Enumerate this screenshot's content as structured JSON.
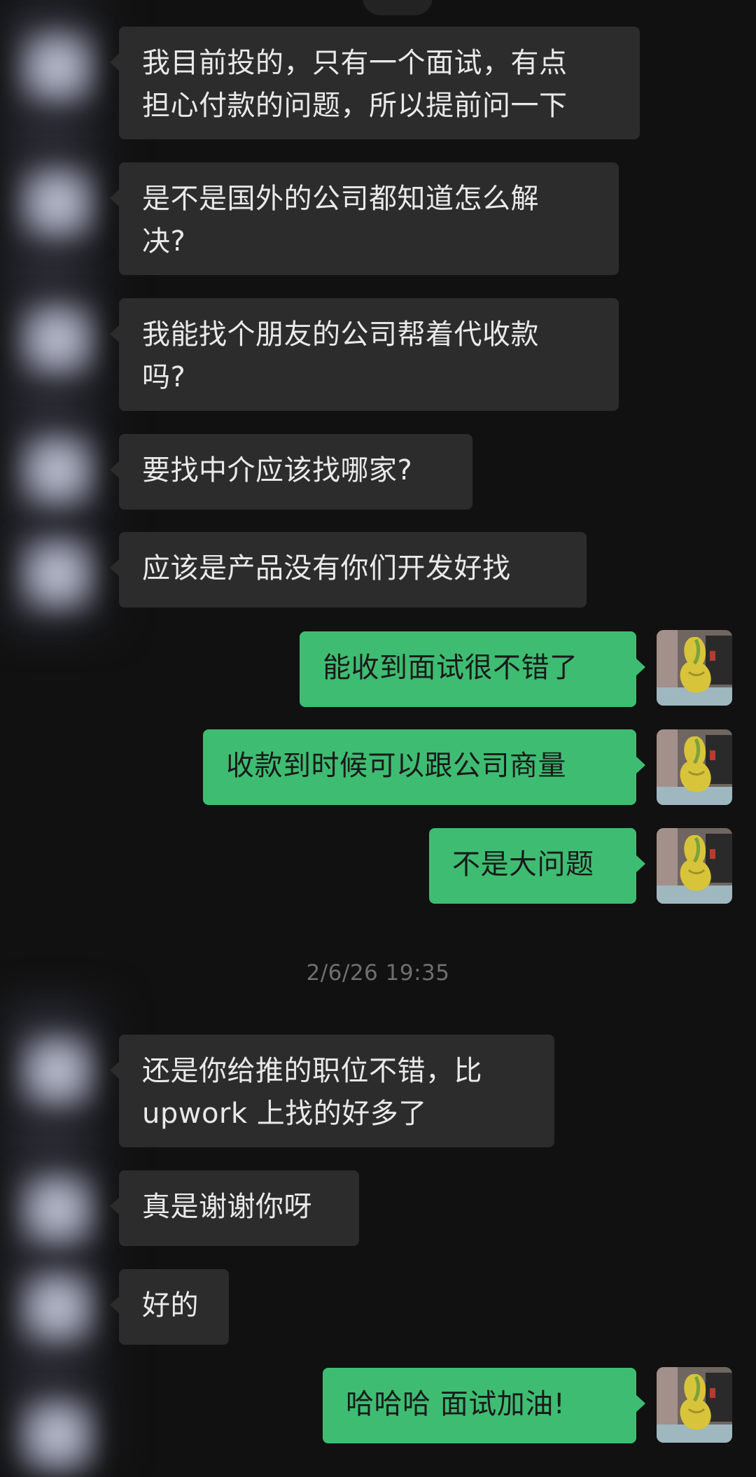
{
  "conversation": {
    "messages": [
      {
        "id": "m1",
        "side": "left",
        "text": "我目前投的，只有一个面试，有点\n担心付款的问题，所以提前问一下"
      },
      {
        "id": "m2",
        "side": "left",
        "text": "是不是国外的公司都知道怎么解\n决?"
      },
      {
        "id": "m3",
        "side": "left",
        "text": "我能找个朋友的公司帮着代收款\n吗?"
      },
      {
        "id": "m4",
        "side": "left",
        "text": "要找中介应该找哪家?"
      },
      {
        "id": "m5",
        "side": "left",
        "text": "应该是产品没有你们开发好找"
      },
      {
        "id": "m6",
        "side": "right",
        "text": "能收到面试很不错了"
      },
      {
        "id": "m7",
        "side": "right",
        "text": "收款到时候可以跟公司商量"
      },
      {
        "id": "m8",
        "side": "right",
        "text": "不是大问题"
      },
      {
        "id": "m9",
        "side": "left",
        "text": "还是你给推的职位不错，比\nupwork 上找的好多了"
      },
      {
        "id": "m10",
        "side": "left",
        "text": "真是谢谢你呀"
      },
      {
        "id": "m11",
        "side": "left",
        "text": "好的"
      },
      {
        "id": "m12",
        "side": "right",
        "text": "哈哈哈 面试加油!"
      }
    ],
    "timestamp": "2/6/26 19:35"
  },
  "colors": {
    "background": "#111111",
    "incoming_bubble": "#2c2c2c",
    "outgoing_bubble": "#3ebd72",
    "incoming_text": "#e9e9e9",
    "outgoing_text": "#1a1a1a",
    "timestamp_text": "#6f6f6f"
  },
  "icons": {
    "contact_avatar": "blurred-avatar-icon",
    "self_avatar": "yellow-sculpture-avatar-icon"
  }
}
